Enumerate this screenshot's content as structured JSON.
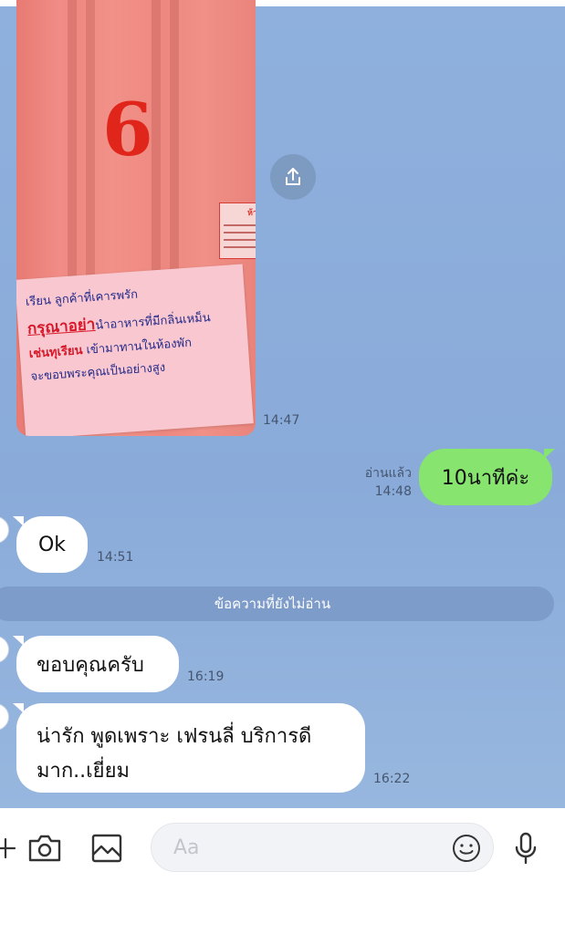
{
  "photo": {
    "door_number": "6",
    "sign_lines": [
      "เรียน ลูกค้าที่เคารพรัก",
      "กรุณาอย่า",
      "นำอาหารที่มีกลิ่นเหม็น",
      "เช่นทุเรียน",
      "เข้ามาทานในห้องพัก",
      "จะขอบพระคุณเป็นอย่างสูง"
    ],
    "small_sign_text": "ห้า",
    "time": "14:47"
  },
  "outgoing": {
    "text": "10นาทีค่ะ",
    "read_label": "อ่านแล้ว",
    "time": "14:48"
  },
  "incoming": [
    {
      "text": "Ok",
      "time": "14:51"
    },
    {
      "text": "ขอบคุณครับ",
      "time": "16:19"
    },
    {
      "text_line1": "น่ารัก พูดเพราะ เฟรนลี่ บริการดี",
      "text_line2": "มาก..เยี่ยม",
      "time": "16:22"
    }
  ],
  "divider_label": "ข้อความที่ยังไม่อ่าน",
  "input": {
    "placeholder": "Aa"
  },
  "icons": [
    "share-icon",
    "plus-icon",
    "camera-icon",
    "image-icon",
    "emoji-icon",
    "mic-icon"
  ],
  "colors": {
    "chat_bg": "#8fb0dd",
    "outgoing_bubble": "#86e46f",
    "incoming_bubble": "#ffffff"
  }
}
